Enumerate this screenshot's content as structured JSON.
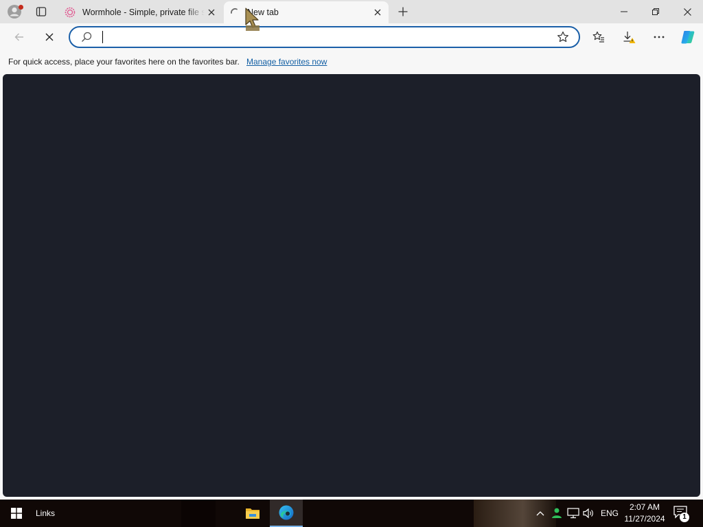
{
  "browser": {
    "tabs": [
      {
        "title": "Wormhole - Simple, private file sh",
        "active": false,
        "favicon": "wormhole-icon"
      },
      {
        "title": "New tab",
        "active": true,
        "favicon": "loading-spinner-icon"
      }
    ],
    "address_bar": {
      "value": "",
      "placeholder": ""
    },
    "favorites_bar": {
      "message": "For quick access, place your favorites here on the favorites bar.",
      "link": "Manage favorites now"
    },
    "content_color": "#1c1f29",
    "accent": "#1a5fa8"
  },
  "taskbar": {
    "links_label": "Links",
    "language": "ENG",
    "time": "2:07 AM",
    "date": "11/27/2024",
    "notification_count": "1",
    "pinned": [
      "file-explorer-icon",
      "edge-icon"
    ]
  }
}
